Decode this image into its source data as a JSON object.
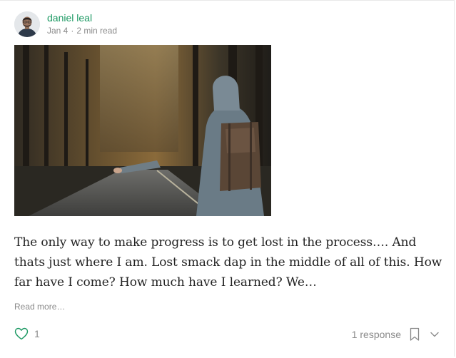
{
  "author": {
    "name": "daniel leal",
    "date": "Jan 4",
    "separator": "·",
    "read_time": "2 min read"
  },
  "post": {
    "excerpt": "The only way to make progress is to get lost in the process…. And thats just where I am. Lost smack dap in the middle of all of this. How far have I come? How much have I learned? We…",
    "read_more": "Read more…"
  },
  "footer": {
    "claps": "1",
    "responses": "1 response"
  },
  "colors": {
    "accent": "#1c9963",
    "muted": "#8a8a8a"
  },
  "icons": [
    "heart-icon",
    "bookmark-icon",
    "chevron-down-icon"
  ]
}
